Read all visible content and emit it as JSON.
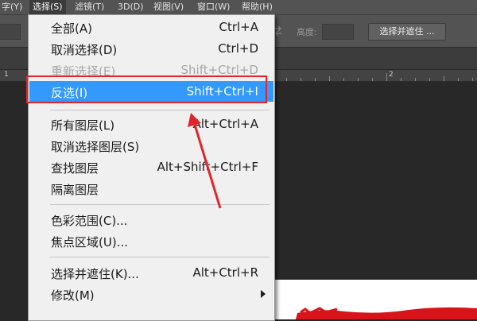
{
  "menubar": {
    "items": [
      {
        "label": "字(Y)"
      },
      {
        "label": "选择(S)"
      },
      {
        "label": "滤镜(T)"
      },
      {
        "label": "3D(D)"
      },
      {
        "label": "视图(V)"
      },
      {
        "label": "窗口(W)"
      },
      {
        "label": "帮助(H)"
      }
    ]
  },
  "options_bar": {
    "height_label": "高度:",
    "select_mask_button": "选择并遮住 ..."
  },
  "ruler": {
    "marks": [
      "1",
      "2"
    ]
  },
  "select_menu": {
    "items": [
      {
        "label": "全部(A)",
        "shortcut": "Ctrl+A"
      },
      {
        "label": "取消选择(D)",
        "shortcut": "Ctrl+D"
      },
      {
        "label": "重新选择(E)",
        "shortcut": "Shift+Ctrl+D",
        "disabled": true
      },
      {
        "label": "反选(I)",
        "shortcut": "Shift+Ctrl+I",
        "highlighted": true
      },
      {
        "label": "所有图层(L)",
        "shortcut": "Alt+Ctrl+A"
      },
      {
        "label": "取消选择图层(S)",
        "shortcut": ""
      },
      {
        "label": "查找图层",
        "shortcut": "Alt+Shift+Ctrl+F"
      },
      {
        "label": "隔离图层",
        "shortcut": ""
      },
      {
        "label": "色彩范围(C)...",
        "shortcut": ""
      },
      {
        "label": "焦点区域(U)...",
        "shortcut": ""
      },
      {
        "label": "选择并遮住(K)...",
        "shortcut": "Alt+Ctrl+R"
      },
      {
        "label": "修改(M)",
        "shortcut": "",
        "submenu": true
      }
    ]
  },
  "colors": {
    "highlight": "#3399ff",
    "annotation": "#e0262b",
    "menu_bg": "#f0f0f0",
    "app_bg": "#282828"
  }
}
